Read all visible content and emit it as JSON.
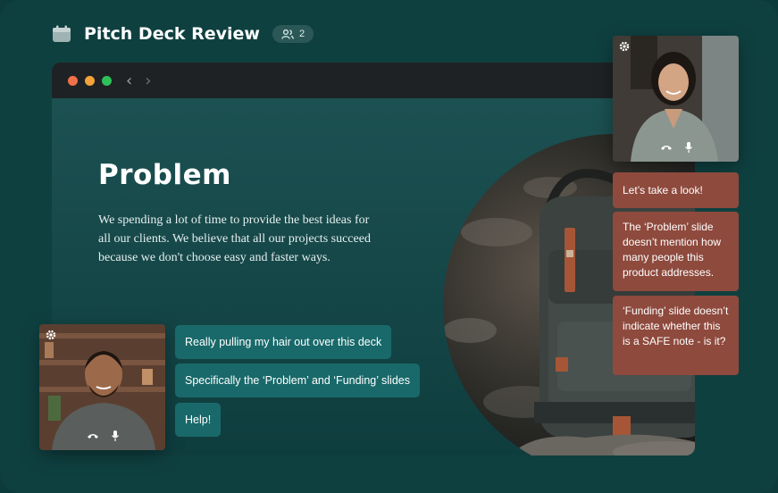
{
  "header": {
    "title": "Pitch Deck Review",
    "participants_count": "2"
  },
  "slide": {
    "title": "Problem",
    "body": "We spending a lot of time to provide the best ideas for all our clients. We believe that all our projects succeed because we don't choose easy and faster ways."
  },
  "chat_left": [
    "Really pulling my hair out over this deck",
    "Specifically the ‘Problem’ and ‘Funding’ slides",
    "Help!"
  ],
  "chat_right": [
    "Let’s take a look!",
    "The ‘Problem’ slide doesn’t mention how many people this product addresses.",
    "‘Funding’ slide doesn’t indicate whether this is a SAFE note - is it?"
  ],
  "colors": {
    "background": "#0f4040",
    "window_bar": "#1f2224",
    "dot_red": "#f0704a",
    "dot_yellow": "#f3a33a",
    "dot_green": "#2fc05a",
    "left_bubble": "#19696a",
    "right_bubble": "#8e4a3d"
  },
  "icons": [
    "calendar-icon",
    "users-icon",
    "back-arrow-icon",
    "forward-arrow-icon",
    "gear-icon",
    "hang-up-icon",
    "microphone-icon"
  ]
}
